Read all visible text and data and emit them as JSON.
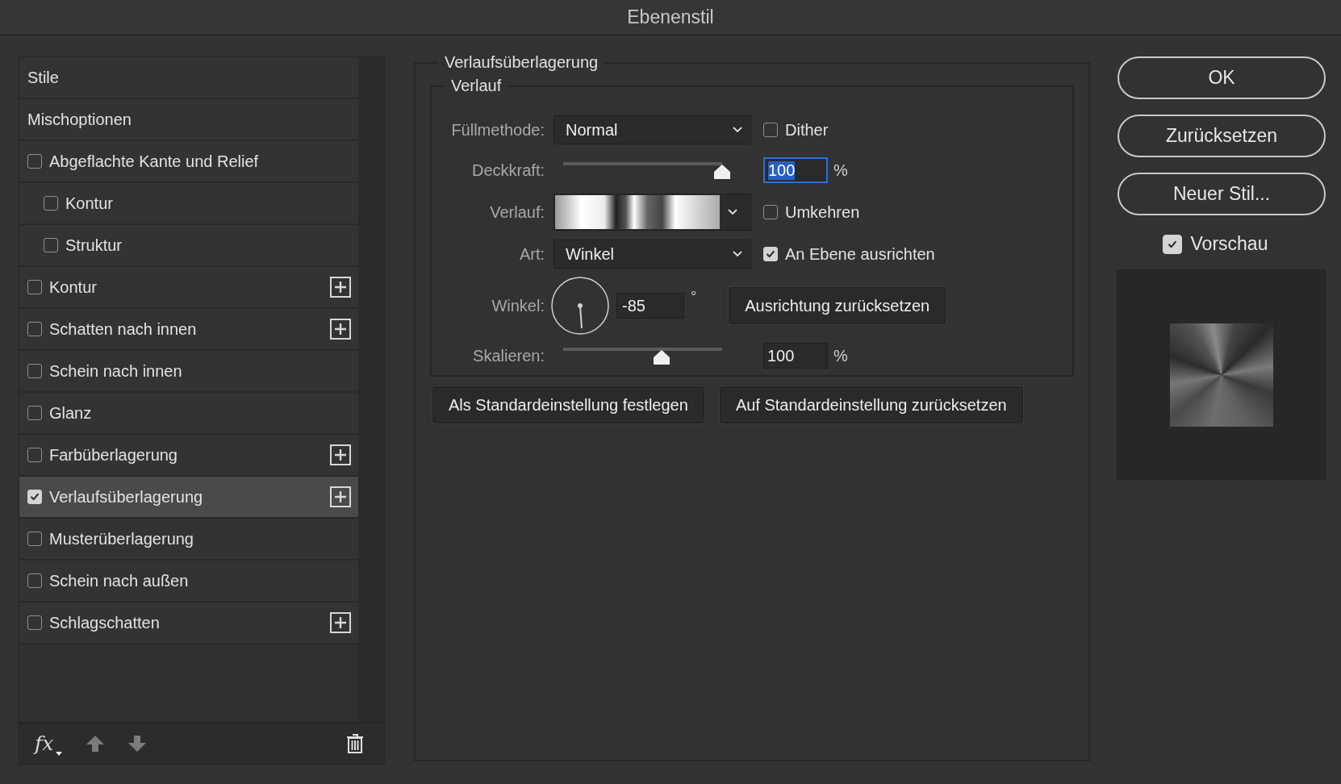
{
  "window": {
    "title": "Ebenenstil"
  },
  "styles_list": {
    "items": [
      {
        "kind": "header",
        "label": "Stile",
        "selected": false
      },
      {
        "kind": "header",
        "label": "Mischoptionen",
        "selected": false
      },
      {
        "kind": "effect",
        "label": "Abgeflachte Kante und Relief",
        "checked": false,
        "selected": false,
        "addable": false,
        "children": [
          {
            "kind": "effect",
            "label": "Kontur",
            "checked": false,
            "selected": false,
            "addable": false
          },
          {
            "kind": "effect",
            "label": "Struktur",
            "checked": false,
            "selected": false,
            "addable": false
          }
        ]
      },
      {
        "kind": "effect",
        "label": "Kontur",
        "checked": false,
        "selected": false,
        "addable": true
      },
      {
        "kind": "effect",
        "label": "Schatten nach innen",
        "checked": false,
        "selected": false,
        "addable": true
      },
      {
        "kind": "effect",
        "label": "Schein nach innen",
        "checked": false,
        "selected": false,
        "addable": false
      },
      {
        "kind": "effect",
        "label": "Glanz",
        "checked": false,
        "selected": false,
        "addable": false
      },
      {
        "kind": "effect",
        "label": "Farbüberlagerung",
        "checked": false,
        "selected": false,
        "addable": true
      },
      {
        "kind": "effect",
        "label": "Verlaufsüberlagerung",
        "checked": true,
        "selected": true,
        "addable": true
      },
      {
        "kind": "effect",
        "label": "Musterüberlagerung",
        "checked": false,
        "selected": false,
        "addable": false
      },
      {
        "kind": "effect",
        "label": "Schein nach außen",
        "checked": false,
        "selected": false,
        "addable": false
      },
      {
        "kind": "effect",
        "label": "Schlagschatten",
        "checked": false,
        "selected": false,
        "addable": true
      }
    ],
    "footer": {
      "fx_label": "fx"
    }
  },
  "panel": {
    "title": "Verlaufsüberlagerung",
    "group_title": "Verlauf",
    "blend_mode": {
      "label": "Füllmethode:",
      "value": "Normal"
    },
    "dither": {
      "label": "Dither",
      "checked": false
    },
    "opacity": {
      "label": "Deckkraft:",
      "level": 1.0,
      "value": "100",
      "unit": "%",
      "focused": true
    },
    "gradient": {
      "label": "Verlauf:"
    },
    "reverse": {
      "label": "Umkehren",
      "checked": false
    },
    "style": {
      "label": "Art:",
      "value": "Winkel"
    },
    "align": {
      "label": "An Ebene ausrichten",
      "checked": true
    },
    "angle": {
      "label": "Winkel:",
      "value": "-85",
      "unit": "°"
    },
    "reset_alignment": "Ausrichtung zurücksetzen",
    "scale": {
      "label": "Skalieren:",
      "level": 0.62,
      "value": "100",
      "unit": "%",
      "focused": false
    },
    "buttons": [
      "Als Standardeinstellung festlegen",
      "Auf Standardeinstellung zurücksetzen"
    ]
  },
  "actions": {
    "buttons": [
      "OK",
      "Zurücksetzen",
      "Neuer Stil..."
    ],
    "preview": {
      "label": "Vorschau",
      "checked": true
    }
  }
}
